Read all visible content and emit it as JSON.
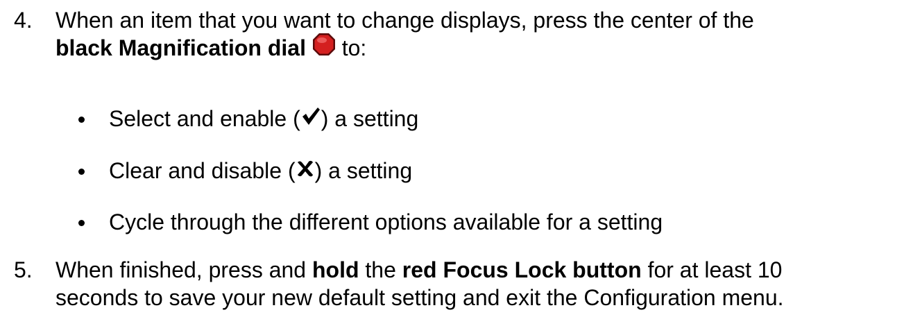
{
  "steps": [
    {
      "number": "4.",
      "line1": "When an item that you want to change displays, press the center of the",
      "line2_bold": "black Magnification dial",
      "line2_after": " to:",
      "dial_icon": "red-octagon-button-icon"
    },
    {
      "number": "5.",
      "seg1": "When finished, press and ",
      "seg2_bold": "hold",
      "seg3": " the ",
      "seg4_bold": "red Focus Lock button",
      "seg5": " for at least 10",
      "line2": "seconds to save your new default setting and exit the Configuration menu."
    }
  ],
  "bullets": [
    {
      "before": "Select and enable (",
      "icon": "checkmark-icon",
      "after": ") a setting"
    },
    {
      "before": "Clear and disable (",
      "icon": "x-mark-icon",
      "after": ") a setting"
    },
    {
      "text": "Cycle through the different options available for a setting"
    }
  ],
  "colors": {
    "dial_red": "#d42020",
    "dial_border": "#5a0a0a",
    "text": "#000000"
  }
}
